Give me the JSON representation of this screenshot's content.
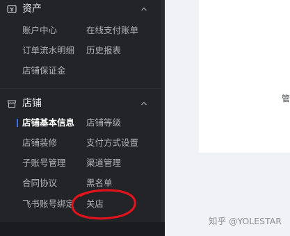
{
  "sidebar": {
    "groups": [
      {
        "title": "资产",
        "icon": "wallet-icon",
        "expanded": true,
        "items": [
          "账户中心",
          "在线支付账单",
          "订单流水明细",
          "历史报表",
          "店铺保证金"
        ]
      },
      {
        "title": "店铺",
        "icon": "store-icon",
        "expanded": true,
        "items": [
          "店铺基本信息",
          "店铺等级",
          "店铺装修",
          "支付方式设置",
          "子账号管理",
          "渠道管理",
          "合同协议",
          "黑名单",
          "飞书账号绑定",
          "关店"
        ],
        "active_item": "店铺基本信息"
      }
    ]
  },
  "main": {
    "truncated_text": "管"
  },
  "watermark": "知乎 @YOLESTAR",
  "annotation": {
    "shape": "hand-drawn red ellipse",
    "target": "关店",
    "color": "#e0141e"
  },
  "colors": {
    "sidebar_bg": "#232427",
    "active_indicator": "#3a6df0",
    "page_bg": "#f1f2f5"
  }
}
